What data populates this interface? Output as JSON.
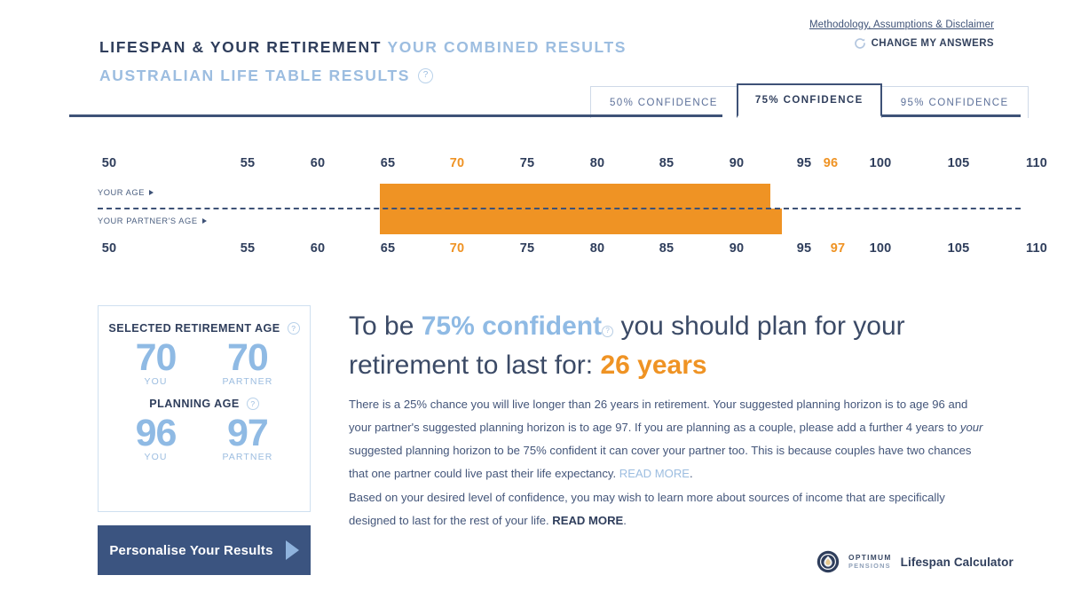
{
  "header": {
    "methodology_link": "Methodology, Assumptions & Disclaimer",
    "change_answers": "CHANGE MY ANSWERS",
    "title_dark": "LIFESPAN & YOUR RETIREMENT",
    "title_light": "YOUR COMBINED RESULTS",
    "subtitle": "AUSTRALIAN LIFE TABLE RESULTS",
    "help_symbol": "?"
  },
  "tabs": [
    {
      "label": "50% CONFIDENCE",
      "active": false
    },
    {
      "label": "75% CONFIDENCE",
      "active": true
    },
    {
      "label": "95% CONFIDENCE",
      "active": false
    }
  ],
  "scale": {
    "axis_min": 50,
    "axis_max": 110,
    "ticks": [
      50,
      55,
      60,
      65,
      70,
      75,
      80,
      85,
      90,
      95,
      100,
      105,
      110
    ],
    "highlight_start": 70,
    "your_row_label": "YOUR AGE",
    "partner_row_label": "YOUR PARTNER'S AGE",
    "your_end": 96,
    "partner_end": 97,
    "bar_color": "#ef9324",
    "tick_color": "#2f3e5c"
  },
  "card": {
    "selected_retirement_age_label": "SELECTED RETIREMENT AGE",
    "planning_age_label": "PLANNING AGE",
    "you_label": "YOU",
    "partner_label": "PARTNER",
    "retirement_age_you": "70",
    "retirement_age_partner": "70",
    "planning_age_you": "96",
    "planning_age_partner": "97"
  },
  "cta": {
    "label": "Personalise Your Results"
  },
  "headline": {
    "part1": "To be ",
    "confidence": "75% confident",
    "part2": " you should plan for your retirement to last for: ",
    "years": "26 years"
  },
  "body": {
    "p1_a": "There is a 25% chance you will live longer than 26 years in retirement. Your suggested planning horizon is to age 96 and your partner's suggested planning horizon is to age 97. If you are planning as a couple, please add a further 4 years to ",
    "p1_italic": "your",
    "p1_b": " suggested planning horizon to be 75% confident it can cover your partner too.  This is because couples have two chances that one partner could live past their life expectancy. ",
    "p1_link": "READ MORE",
    "p1_end": ".",
    "p2_a": "Based on your desired level of confidence, you may wish to learn more about sources of income that are specifically designed to last for the rest of your life. ",
    "p2_link": "READ MORE",
    "p2_end": "."
  },
  "brand": {
    "logo_line1": "OPTIMUM",
    "logo_line2": "PENSIONS",
    "product": "Lifespan Calculator"
  },
  "colors": {
    "orange": "#ef9324",
    "navy": "#2f3e5c",
    "light_blue": "#9cbde0",
    "cta_blue": "#3b5480"
  }
}
